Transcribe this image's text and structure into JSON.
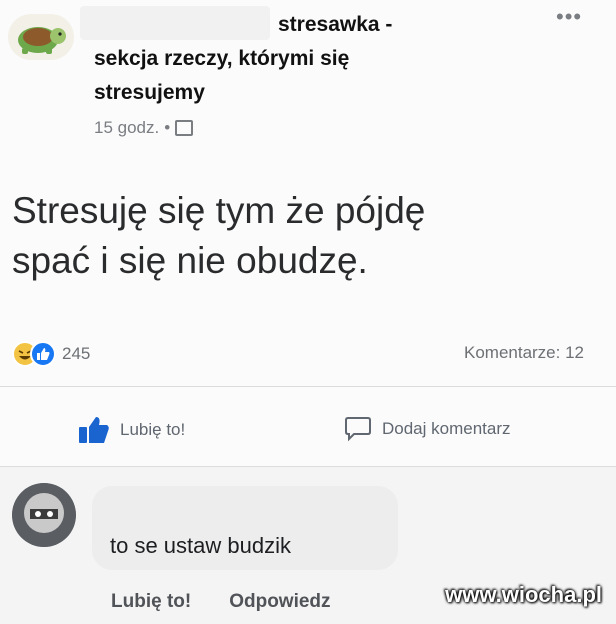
{
  "post": {
    "group_title_line1": "stresawka -",
    "group_title_line2": "sekcja rzeczy, którymi się",
    "group_title_line3": "stresujemy",
    "time": "15 godz.",
    "separator": "•",
    "text_line1": "Stresuję się tym że pójdę",
    "text_line2": "spać i się nie obudzę.",
    "reaction_count": "245",
    "comments_label": "Komentarze: 12",
    "like_label": "Lubię to!",
    "comment_label": "Dodaj komentarz"
  },
  "comment": {
    "text": "to se ustaw budzik",
    "like_label": "Lubię to!",
    "reply_label": "Odpowiedz"
  },
  "watermark": "www.wiocha.pl",
  "icons": {
    "more": "more-options-icon",
    "audience": "audience-icon",
    "haha": "haha-reaction-icon",
    "like_reaction": "like-reaction-icon",
    "like_thumb": "thumbs-up-icon",
    "comment_bubble": "comment-icon"
  },
  "colors": {
    "accent": "#1877f2",
    "muted": "#6d7074"
  }
}
